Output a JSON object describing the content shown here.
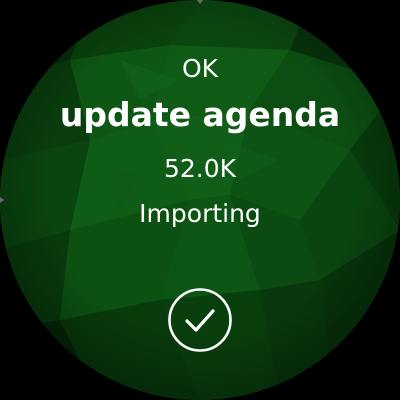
{
  "screen": {
    "status_label": "OK",
    "title": "update agenda",
    "value": "52.0K",
    "subtitle": "Importing"
  },
  "actions": {
    "confirm_icon": "checkmark-icon"
  },
  "colors": {
    "background_base": "#0b4a10",
    "text": "#ffffff",
    "bezel": "#000000",
    "icon_stroke": "#ffffff"
  }
}
